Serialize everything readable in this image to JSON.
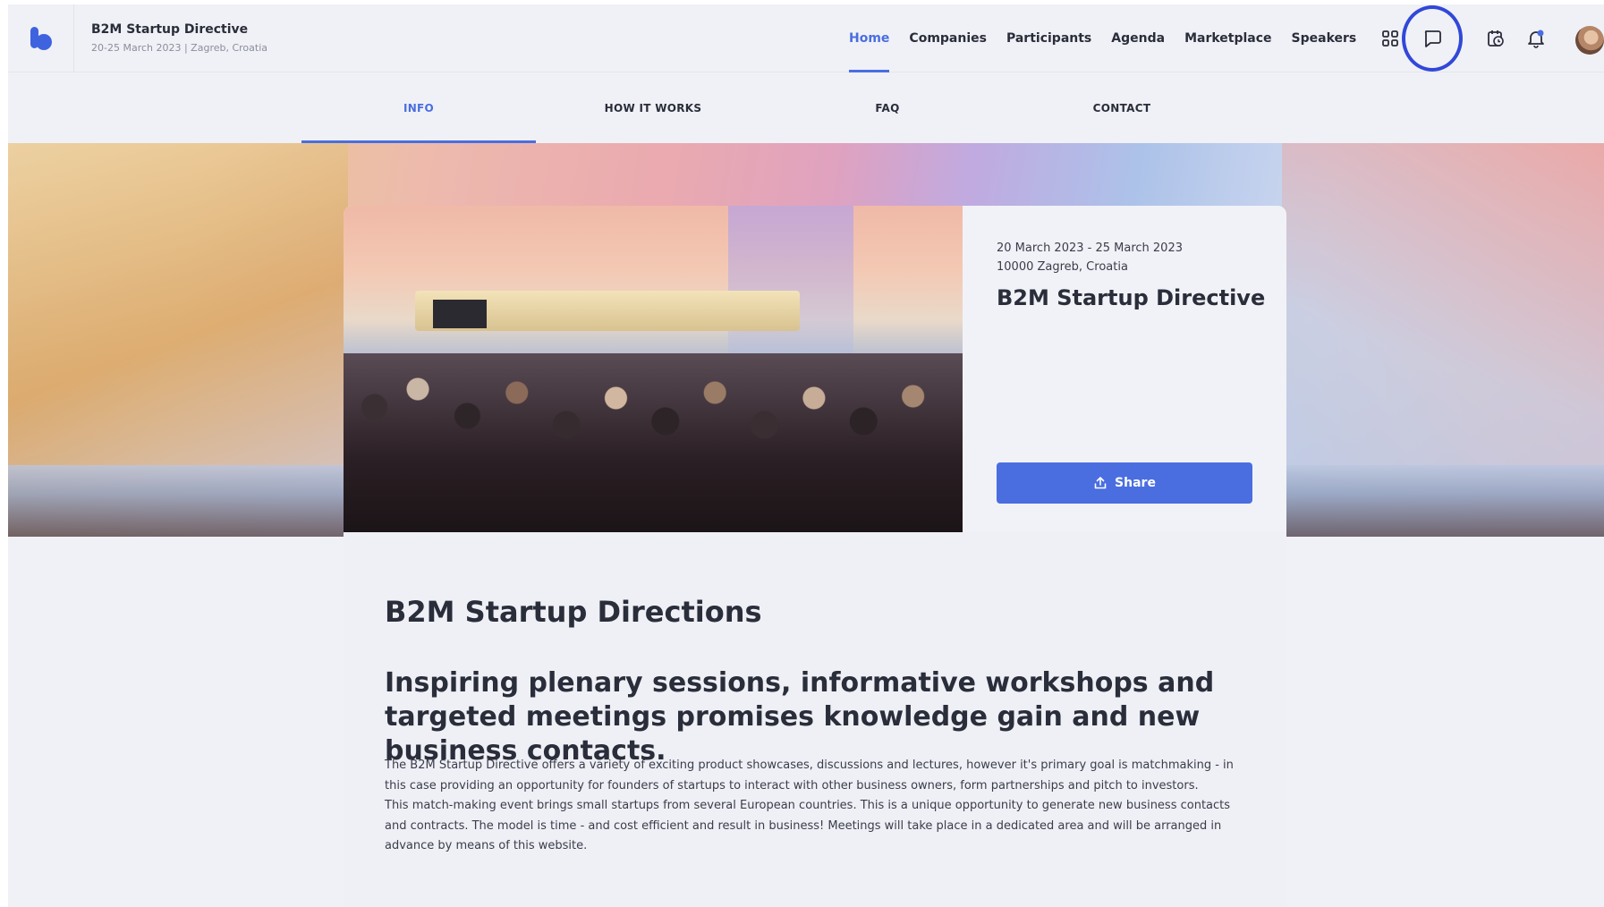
{
  "header": {
    "event_title": "B2M Startup Directive",
    "event_subtitle": "20-25 March 2023 | Zagreb, Croatia",
    "nav": [
      {
        "label": "Home",
        "active": true
      },
      {
        "label": "Companies",
        "active": false
      },
      {
        "label": "Participants",
        "active": false
      },
      {
        "label": "Agenda",
        "active": false
      },
      {
        "label": "Marketplace",
        "active": false
      },
      {
        "label": "Speakers",
        "active": false
      }
    ],
    "icons": [
      "apps-grid-icon",
      "chat-icon",
      "calendar-clock-icon",
      "notification-bell-icon",
      "user-avatar"
    ]
  },
  "subtabs": [
    {
      "label": "INFO",
      "active": true
    },
    {
      "label": "HOW IT WORKS",
      "active": false
    },
    {
      "label": "FAQ",
      "active": false
    },
    {
      "label": "CONTACT",
      "active": false
    }
  ],
  "event_card": {
    "dates": "20 March 2023 - 25 March 2023",
    "location": "10000 Zagreb, Croatia",
    "title": "B2M Startup Directive",
    "share_label": "Share"
  },
  "content": {
    "heading": "B2M Startup Directions",
    "subheading": "Inspiring plenary sessions, informative workshops and targeted meetings promises knowledge gain and new business contacts.",
    "paragraph_1": "The B2M Startup Directive offers a variety of exciting product showcases, discussions and lectures, however it's primary goal is matchmaking - in this case providing an opportunity for founders of startups to interact with other business owners, form partnerships and pitch to investors.",
    "paragraph_2": "This match-making event brings small startups from several European countries. This is a unique opportunity to generate new business contacts and contracts. The model is time - and cost efficient and result in business! Meetings will take place in a dedicated area and will be arranged in advance by means of this website."
  },
  "colors": {
    "accent": "#4a6ee0",
    "highlight_ring": "#3148d8",
    "background": "#f0f1f6",
    "text": "#2a2d3a"
  }
}
